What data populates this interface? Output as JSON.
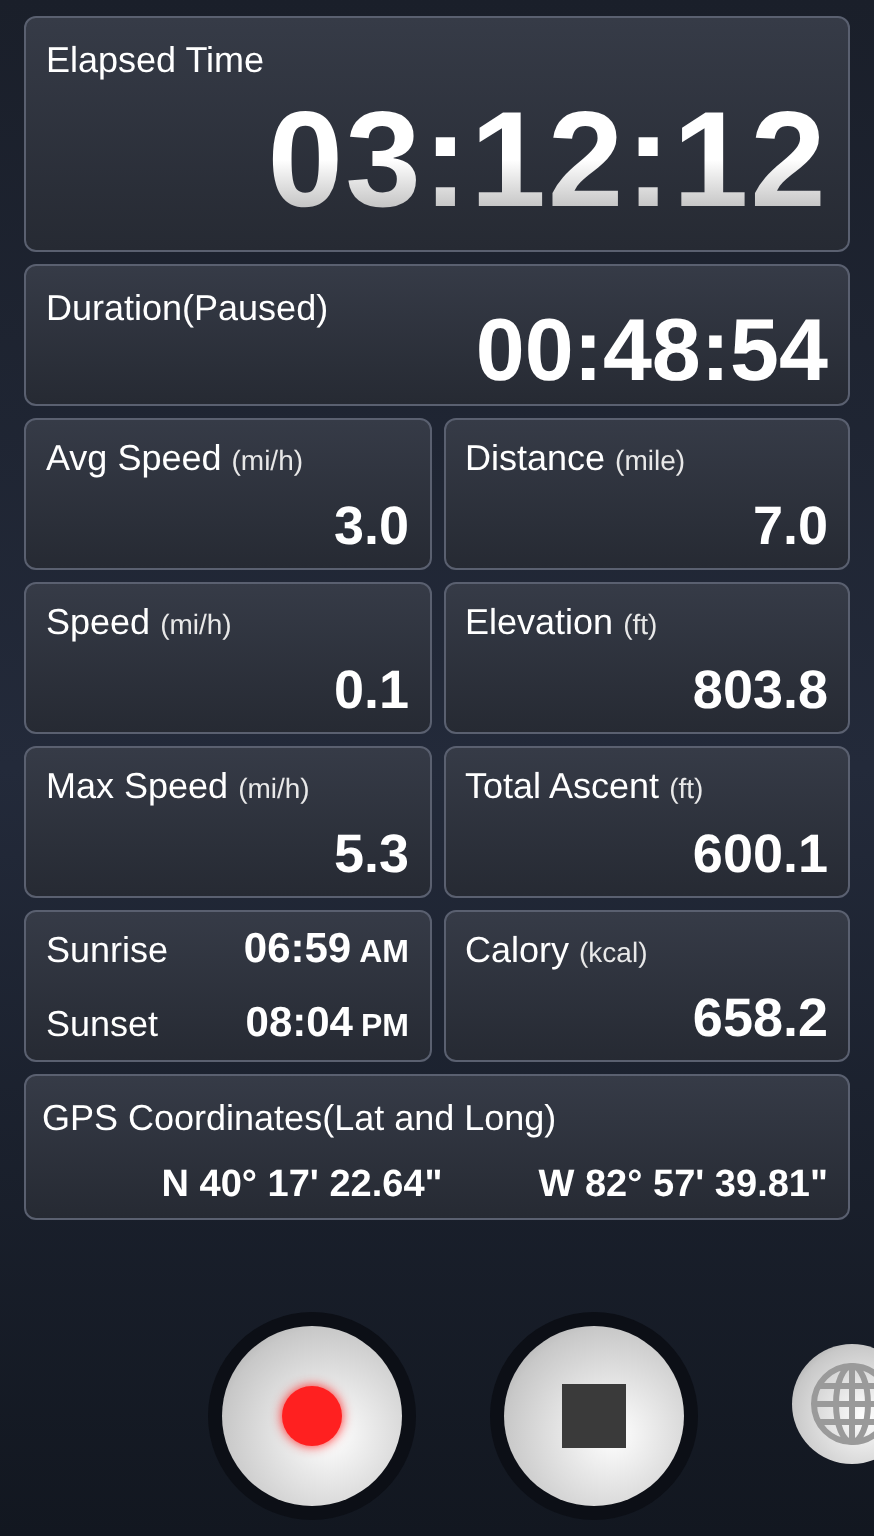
{
  "elapsed": {
    "label": "Elapsed Time",
    "value": "03:12:12"
  },
  "duration": {
    "label": "Duration(Paused)",
    "value": "00:48:54"
  },
  "tiles": [
    {
      "kind": "metric",
      "label": "Avg Speed",
      "unit": "(mi/h)",
      "value": "3.0"
    },
    {
      "kind": "metric",
      "label": "Distance",
      "unit": "(mile)",
      "value": "7.0"
    },
    {
      "kind": "metric",
      "label": "Speed",
      "unit": "(mi/h)",
      "value": "0.1"
    },
    {
      "kind": "metric",
      "label": "Elevation",
      "unit": "(ft)",
      "value": "803.8"
    },
    {
      "kind": "metric",
      "label": "Max Speed",
      "unit": "(mi/h)",
      "value": "5.3"
    },
    {
      "kind": "metric",
      "label": "Total Ascent",
      "unit": "(ft)",
      "value": "600.1"
    },
    {
      "kind": "sun",
      "rows": [
        {
          "label": "Sunrise",
          "time": "06:59",
          "period": "AM"
        },
        {
          "label": "Sunset",
          "time": "08:04",
          "period": "PM"
        }
      ]
    },
    {
      "kind": "metric",
      "label": "Calory",
      "unit": "(kcal)",
      "value": "658.2"
    }
  ],
  "gps": {
    "label": "GPS Coordinates(Lat and Long)",
    "lat": "N 40° 17' 22.64\"",
    "long": "W 82° 57' 39.81\""
  }
}
